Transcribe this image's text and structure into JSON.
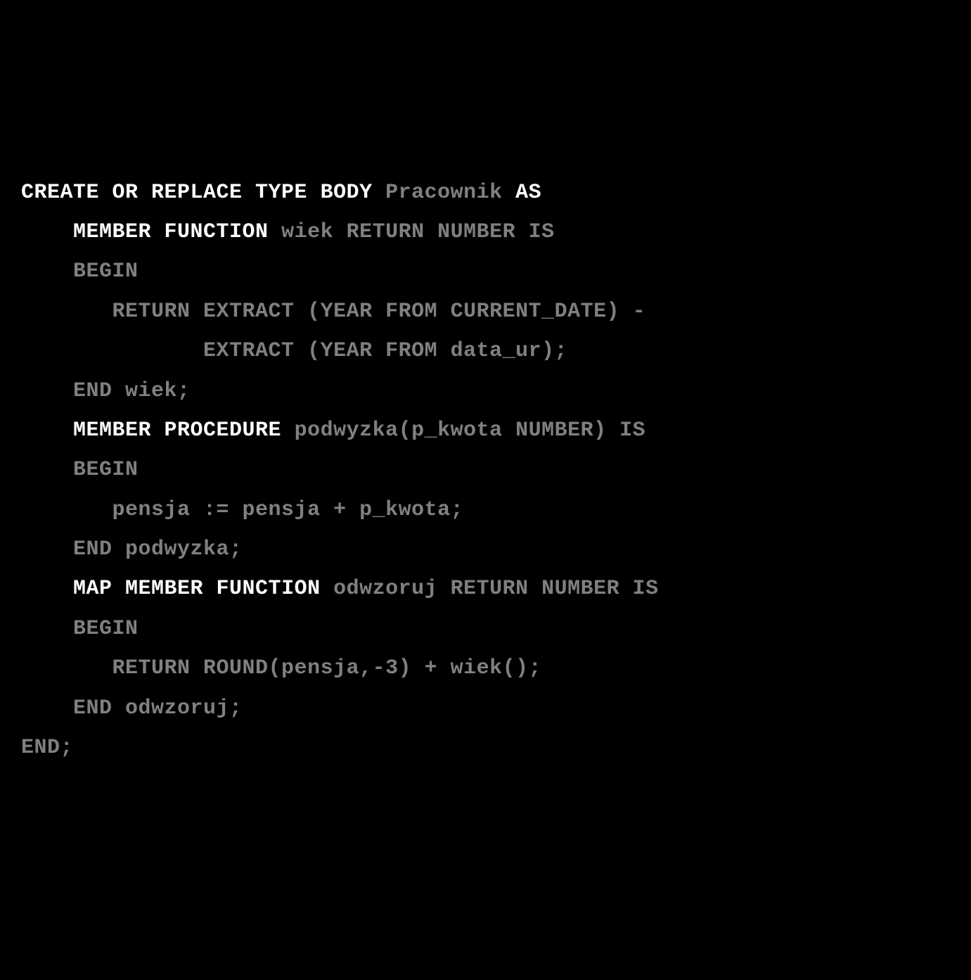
{
  "code": {
    "line1_bold": "CREATE OR REPLACE TYPE BODY",
    "line1_rest": " Pracownik ",
    "line1_as": "AS",
    "line2_indent": "    ",
    "line2_bold": "MEMBER FUNCTION",
    "line2_rest": " wiek RETURN NUMBER IS",
    "line3": "    BEGIN",
    "line4": "       RETURN EXTRACT (YEAR FROM CURRENT_DATE) -",
    "line5": "              EXTRACT (YEAR FROM data_ur);",
    "line6": "    END wiek;",
    "line7_indent": "    ",
    "line7_bold": "MEMBER PROCEDURE",
    "line7_rest": " podwyzka(p_kwota NUMBER) IS",
    "line8": "    BEGIN",
    "line9": "       pensja := pensja + p_kwota;",
    "line10": "    END podwyzka;",
    "line11_indent": "    ",
    "line11_bold": "MAP MEMBER FUNCTION",
    "line11_rest": " odwzoruj RETURN NUMBER IS",
    "line12": "    BEGIN",
    "line13": "       RETURN ROUND(pensja,-3) + wiek();",
    "line14": "    END odwzoruj;",
    "line15": "END;"
  }
}
